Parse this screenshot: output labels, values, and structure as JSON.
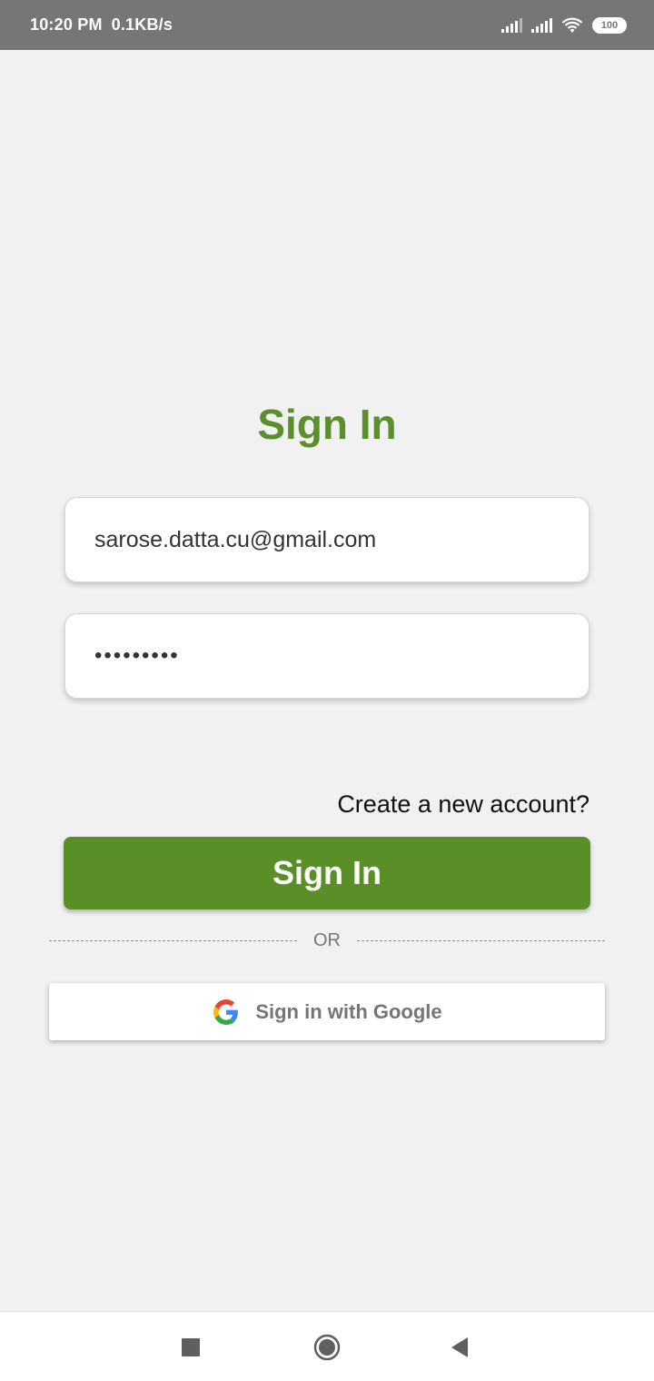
{
  "status_bar": {
    "time": "10:20 PM",
    "net_speed": "0.1KB/s",
    "battery": "100"
  },
  "title": "Sign In",
  "form": {
    "email_value": "sarose.datta.cu@gmail.com",
    "password_value": "•••••••••",
    "create_account_label": "Create a new account?",
    "signin_label": "Sign In",
    "or_label": "OR",
    "google_label": "Sign in with Google"
  },
  "colors": {
    "accent": "#5a8f28",
    "status_bar": "#767676",
    "background": "#f1f1f1"
  },
  "icons": {
    "status": [
      "signal-icon",
      "signal-icon",
      "wifi-icon",
      "battery-icon"
    ],
    "google": "google-g-icon",
    "nav": [
      "recent-apps-icon",
      "home-icon",
      "back-icon"
    ]
  }
}
